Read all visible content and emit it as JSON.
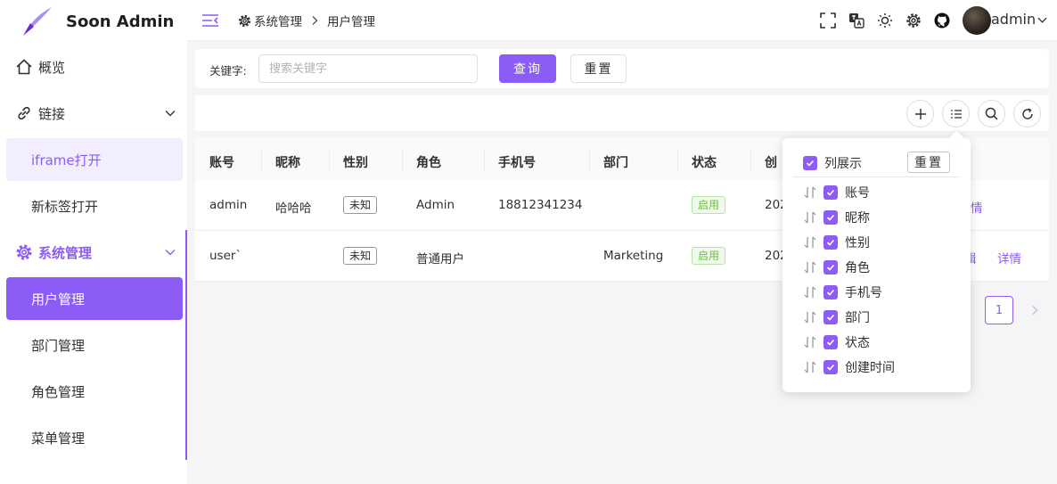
{
  "app": {
    "name": "Soon Admin"
  },
  "colors": {
    "accent": "#8b5cf6",
    "success": "#67c23a"
  },
  "sidebar": {
    "overview": {
      "label": "概览",
      "icon": "home-icon"
    },
    "links": {
      "label": "链接",
      "icon": "link-icon"
    },
    "iframe": {
      "label": "iframe打开"
    },
    "new_tab": {
      "label": "新标签打开"
    },
    "system": {
      "label": "系统管理",
      "icon": "gear-icon"
    },
    "items": [
      {
        "label": "用户管理",
        "active": true
      },
      {
        "label": "部门管理"
      },
      {
        "label": "角色管理"
      },
      {
        "label": "菜单管理"
      }
    ]
  },
  "header": {
    "breadcrumb": [
      "系统管理",
      "用户管理"
    ],
    "username": "admin"
  },
  "search": {
    "label": "关键字:",
    "placeholder": "搜索关键字",
    "value": "",
    "query_label": "查询",
    "reset_label": "重置"
  },
  "table": {
    "columns": [
      "账号",
      "昵称",
      "性别",
      "角色",
      "手机号",
      "部门",
      "状态",
      "创"
    ],
    "rows": [
      {
        "account": "admin",
        "nickname": "哈哈哈",
        "gender": "未知",
        "role": "Admin",
        "phone": "18812341234",
        "dept": "",
        "status": "启用",
        "created": "202",
        "actions": [
          "情"
        ]
      },
      {
        "account": "user`",
        "nickname": "",
        "gender": "未知",
        "role": "普通用户",
        "phone": "",
        "dept": "Marketing",
        "status": "启用",
        "created": "202",
        "actions": [
          "辑",
          "详情"
        ]
      }
    ],
    "pagination": {
      "current": "1"
    }
  },
  "column_popover": {
    "title": "列展示",
    "reset_label": "重置",
    "columns": [
      "账号",
      "昵称",
      "性别",
      "角色",
      "手机号",
      "部门",
      "状态",
      "创建时间"
    ]
  }
}
